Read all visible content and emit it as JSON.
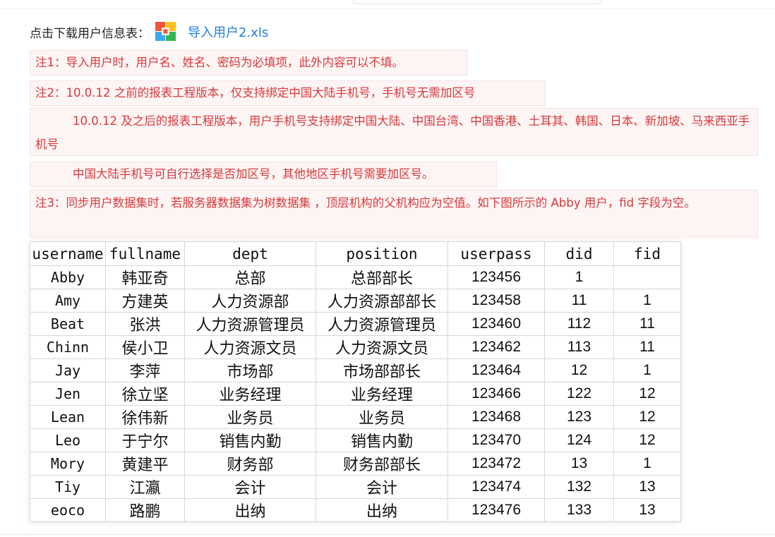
{
  "download": {
    "label": "点击下载用户信息表：",
    "file_name": "导入用户2.xls",
    "icon": "xls-file-icon",
    "link_color": "#1f7fdc"
  },
  "notes": {
    "note1": "注1：导入用户时，用户名、姓名、密码为必填项，此外内容可以不填。",
    "note2": "注2：10.0.12 之前的报表工程版本，仅支持绑定中国大陆手机号，手机号无需加区号",
    "note2_cont": "10.0.12 及之后的报表工程版本，用户手机号支持绑定中国大陆、中国台湾、中国香港、土耳其、韩国、日本、新加坡、马来西亚手机号",
    "note2_cont2": "中国大陆手机号可自行选择是否加区号，其他地区手机号需要加区号。",
    "note3": "注3：同步用户数据集时，若服务器数据集为树数据集 ，顶层机构的父机构应为空值。如下图所示的 Abby 用户，fid 字段为空。",
    "text_color": "#d8393b",
    "bg_color": "#fdf4f4"
  },
  "table": {
    "headers": [
      "username",
      "fullname",
      "dept",
      "position",
      "userpass",
      "did",
      "fid"
    ],
    "rows": [
      [
        "Abby",
        "韩亚奇",
        "总部",
        "总部部长",
        "123456",
        "1",
        ""
      ],
      [
        "Amy",
        "方建英",
        "人力资源部",
        "人力资源部部长",
        "123458",
        "11",
        "1"
      ],
      [
        "Beat",
        "张洪",
        "人力资源管理员",
        "人力资源管理员",
        "123460",
        "112",
        "11"
      ],
      [
        "Chinn",
        "侯小卫",
        "人力资源文员",
        "人力资源文员",
        "123462",
        "113",
        "11"
      ],
      [
        "Jay",
        "李萍",
        "市场部",
        "市场部部长",
        "123464",
        "12",
        "1"
      ],
      [
        "Jen",
        "徐立坚",
        "业务经理",
        "业务经理",
        "123466",
        "122",
        "12"
      ],
      [
        "Lean",
        "徐伟新",
        "业务员",
        "业务员",
        "123468",
        "123",
        "12"
      ],
      [
        "Leo",
        "于宁尔",
        "销售内勤",
        "销售内勤",
        "123470",
        "124",
        "12"
      ],
      [
        "Mory",
        "黄建平",
        "财务部",
        "财务部部长",
        "123472",
        "13",
        "1"
      ],
      [
        "Tiy",
        "江瀛",
        "会计",
        "会计",
        "123474",
        "132",
        "13"
      ],
      [
        "eoco",
        "路鹏",
        "出纳",
        "出纳",
        "123476",
        "133",
        "13"
      ]
    ]
  }
}
